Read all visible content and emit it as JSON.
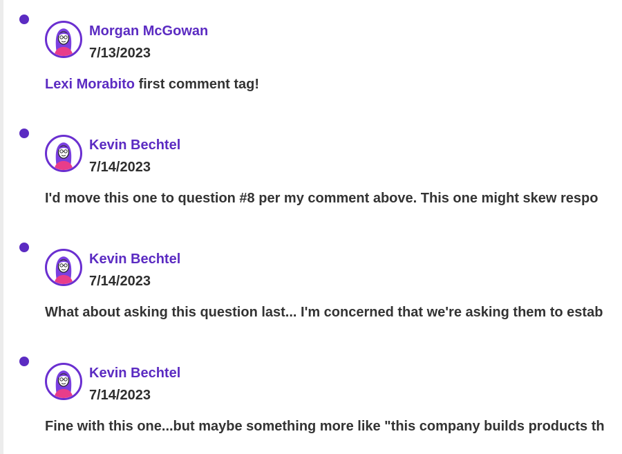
{
  "comments": [
    {
      "author": "Morgan McGowan",
      "date": "7/13/2023",
      "mention": "Lexi Morabito",
      "text": " first comment tag!"
    },
    {
      "author": "Kevin Bechtel",
      "date": "7/14/2023",
      "text": "I'd move this one to question #8 per my comment above. This one might skew respo"
    },
    {
      "author": "Kevin Bechtel",
      "date": "7/14/2023",
      "text": "What about asking this question last... I'm concerned that we're asking them to estab"
    },
    {
      "author": "Kevin Bechtel",
      "date": "7/14/2023",
      "text": "Fine with this one...but maybe something more like \"this company builds products th"
    }
  ],
  "colors": {
    "accent": "#5b2bc2",
    "text": "#2e2e2e"
  },
  "icons": {
    "timeline_dot": "timeline-dot-icon",
    "avatar": "avatar-illustration-icon"
  }
}
